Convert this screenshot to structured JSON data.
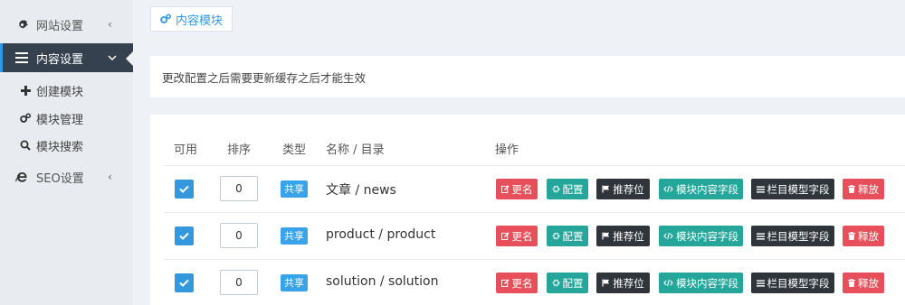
{
  "sidebar": {
    "items": [
      {
        "label": "网站设置",
        "icon": "gear-icon",
        "chevron": "‹"
      },
      {
        "label": "内容设置",
        "icon": "menu-icon",
        "chevron": "⌄"
      },
      {
        "label": "SEO设置",
        "icon": "ie-icon",
        "chevron": "‹"
      }
    ],
    "sub_items": [
      {
        "label": "创建模块",
        "icon": "plus-icon"
      },
      {
        "label": "模块管理",
        "icon": "cogs-icon"
      },
      {
        "label": "模块搜索",
        "icon": "search-icon"
      }
    ]
  },
  "tab": {
    "label": "内容模块",
    "icon": "cogs-icon"
  },
  "notice": "更改配置之后需要更新缓存之后才能生效",
  "table": {
    "headers": [
      "可用",
      "排序",
      "类型",
      "名称 / 目录",
      "操作"
    ],
    "rows": [
      {
        "enabled": true,
        "order": "0",
        "type": "共享",
        "name": "文章 / news"
      },
      {
        "enabled": true,
        "order": "0",
        "type": "共享",
        "name": "product / product"
      },
      {
        "enabled": true,
        "order": "0",
        "type": "共享",
        "name": "solution / solution"
      }
    ],
    "actions": [
      {
        "label": "更名",
        "icon": "edit-icon",
        "color": "#e7505a"
      },
      {
        "label": "配置",
        "icon": "gear-icon",
        "color": "#26a69a"
      },
      {
        "label": "推荐位",
        "icon": "flag-icon",
        "color": "#2f353b"
      },
      {
        "label": "模块内容字段",
        "icon": "code-icon",
        "color": "#26a69a"
      },
      {
        "label": "栏目模型字段",
        "icon": "list-icon",
        "color": "#2f353b"
      },
      {
        "label": "释放",
        "icon": "trash-icon",
        "color": "#e7505a"
      }
    ]
  },
  "colors": {
    "accent": "#3598dc",
    "sidebar_active": "#364150",
    "badge": "#3aa2e8"
  }
}
